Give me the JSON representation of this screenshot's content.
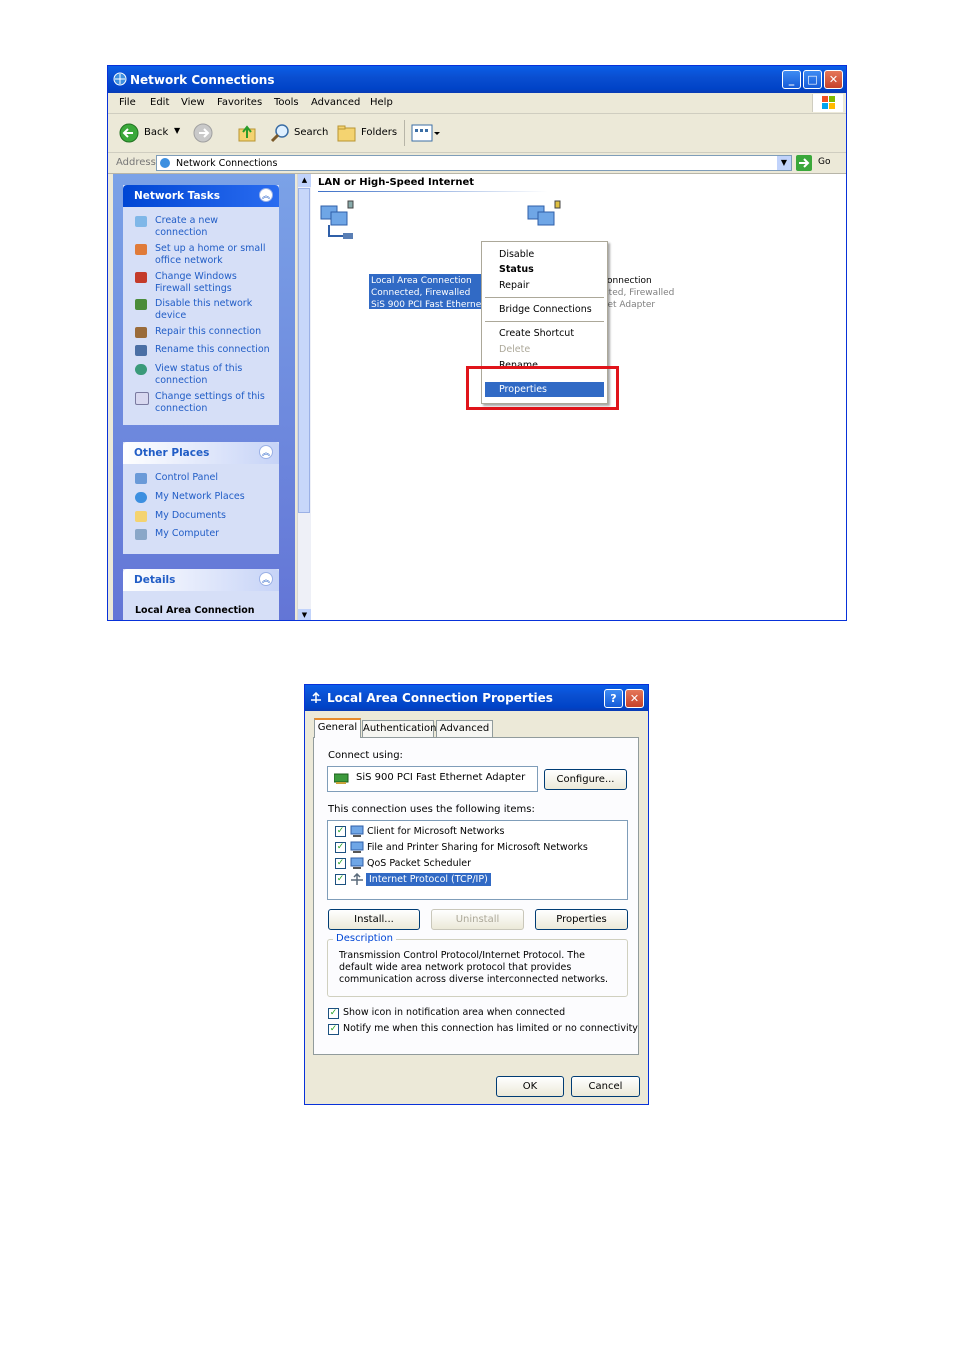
{
  "window1": {
    "title": "Network Connections",
    "menu": [
      "File",
      "Edit",
      "View",
      "Favorites",
      "Tools",
      "Advanced",
      "Help"
    ],
    "toolbar": {
      "back": "Back",
      "search": "Search",
      "folders": "Folders"
    },
    "address": {
      "label": "Address",
      "value": "Network Connections",
      "go": "Go"
    },
    "network_tasks": {
      "title": "Network Tasks",
      "items": [
        "Create a new connection",
        "Set up a home or small office network",
        "Change Windows Firewall settings",
        "Disable this network device",
        "Repair this connection",
        "Rename this connection",
        "View status of this connection",
        "Change settings of this connection"
      ]
    },
    "other_places": {
      "title": "Other Places",
      "items": [
        "Control Panel",
        "My Network Places",
        "My Documents",
        "My Computer"
      ]
    },
    "details": {
      "title": "Details",
      "subtitle": "Local Area Connection"
    },
    "group_header": "LAN or High-Speed Internet",
    "connections": [
      {
        "name": "Local Area Connection",
        "status": "Connected, Firewalled",
        "device": "SiS 900 PCI Fast Ethernet Ada..."
      },
      {
        "name": "1394 Connection",
        "status": "Connected, Firewalled",
        "device": "1394 Net Adapter"
      }
    ],
    "context_menu": [
      "Disable",
      "Status",
      "Repair",
      "Bridge Connections",
      "Create Shortcut",
      "Delete",
      "Rename",
      "Properties"
    ]
  },
  "window2": {
    "title": "Local Area Connection Properties",
    "tabs": [
      "General",
      "Authentication",
      "Advanced"
    ],
    "connect_using_label": "Connect using:",
    "adapter": "SiS 900 PCI Fast Ethernet Adapter",
    "configure": "Configure...",
    "items_label": "This connection uses the following items:",
    "items": [
      "Client for Microsoft Networks",
      "File and Printer Sharing for Microsoft Networks",
      "QoS Packet Scheduler",
      "Internet Protocol (TCP/IP)"
    ],
    "install": "Install...",
    "uninstall": "Uninstall",
    "properties": "Properties",
    "description_label": "Description",
    "description": "Transmission Control Protocol/Internet Protocol. The default wide area network protocol that provides communication across diverse interconnected networks.",
    "show_icon": "Show icon in notification area when connected",
    "notify": "Notify me when this connection has limited or no connectivity",
    "ok": "OK",
    "cancel": "Cancel",
    "help_glyph": "?",
    "close_glyph": "✕"
  },
  "colors": {
    "xp_blue": "#0a4fd1",
    "selection": "#316ac5",
    "callout_red": "#e0141a"
  }
}
